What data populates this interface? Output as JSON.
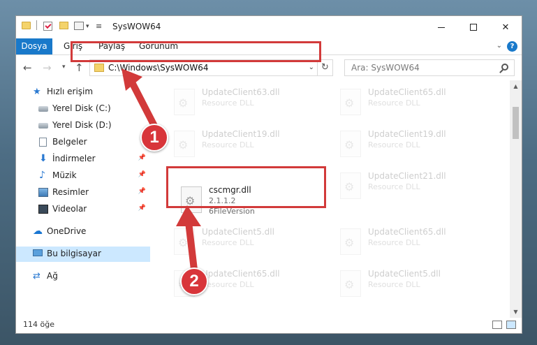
{
  "window": {
    "title": "SysWOW64",
    "quick_access_pin": "≡",
    "controls": {
      "minimize": "",
      "maximize": "",
      "close": "✕"
    }
  },
  "ribbon": {
    "tabs": [
      "Dosya",
      "Giriş",
      "Paylaş",
      "Görünüm"
    ],
    "help": "?"
  },
  "navbar": {
    "address": "C:\\Windows\\SysWOW64",
    "search_placeholder": "Ara: SysWOW64"
  },
  "sidebar": {
    "items": [
      {
        "label": "Hızlı erişim",
        "icon": "star-icon",
        "pinned": false
      },
      {
        "label": "Yerel Disk (C:)",
        "icon": "disk-icon",
        "pinned": false
      },
      {
        "label": "Yerel Disk (D:)",
        "icon": "disk-icon",
        "pinned": false
      },
      {
        "label": "Belgeler",
        "icon": "document-icon",
        "pinned": false
      },
      {
        "label": "İndirmeler",
        "icon": "download-icon",
        "pinned": true
      },
      {
        "label": "Müzik",
        "icon": "music-icon",
        "pinned": true
      },
      {
        "label": "Resimler",
        "icon": "pictures-icon",
        "pinned": true
      },
      {
        "label": "Videolar",
        "icon": "video-icon",
        "pinned": true
      },
      {
        "label": "OneDrive",
        "icon": "cloud-icon",
        "pinned": false
      },
      {
        "label": "Bu bilgisayar",
        "icon": "computer-icon",
        "pinned": false,
        "selected": true
      },
      {
        "label": "Ağ",
        "icon": "network-icon",
        "pinned": false
      }
    ]
  },
  "files": [
    {
      "name": "UpdateClient63.dll",
      "type": "Resource DLL",
      "faded": true
    },
    {
      "name": "UpdateClient65.dll",
      "type": "Resource DLL",
      "faded": true
    },
    {
      "name": "UpdateClient19.dll",
      "type": "Resource DLL",
      "faded": true
    },
    {
      "name": "UpdateClient19.dll",
      "type": "Resource DLL",
      "faded": true
    },
    {
      "name": "cscmgr.dll",
      "type": "2.1.1.2",
      "version": "6FileVersion",
      "faded": false
    },
    {
      "name": "UpdateClient21.dll",
      "type": "Resource DLL",
      "faded": true
    },
    {
      "name": "UpdateClient5.dll",
      "type": "Resource DLL",
      "faded": true
    },
    {
      "name": "UpdateClient65.dll",
      "type": "Resource DLL",
      "faded": true
    },
    {
      "name": "UpdateClient65.dll",
      "type": "Resource DLL",
      "faded": true
    },
    {
      "name": "UpdateClient5.dll",
      "type": "Resource DLL",
      "faded": true
    }
  ],
  "status": {
    "item_count": "114 öğe"
  },
  "annotations": {
    "step1": "1",
    "step2": "2",
    "color": "#d23a3a"
  }
}
